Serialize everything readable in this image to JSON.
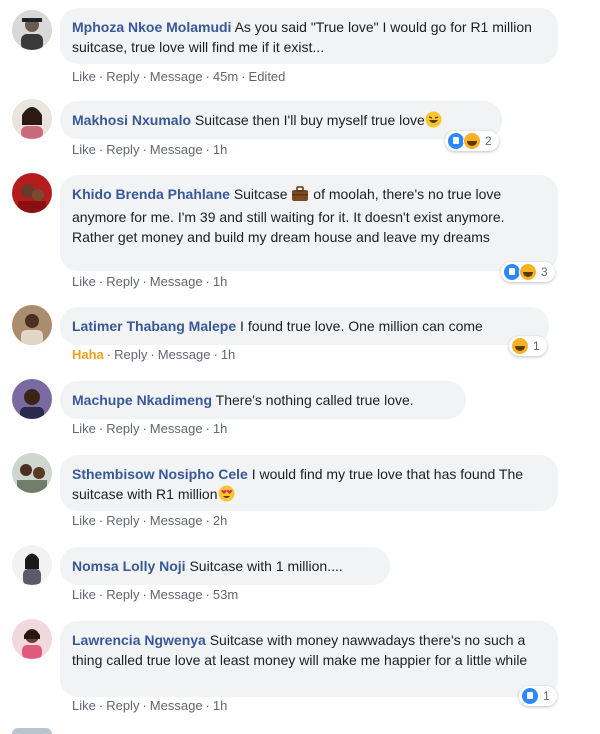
{
  "comments": [
    {
      "author": "Mphoza Nkoe Molamudi",
      "text": "As you said \"True love\" I would go for R1 million suitcase, true love will find me if it exist...",
      "actions": [
        "Like",
        "Reply",
        "Message"
      ],
      "time": "45m",
      "edited": "Edited"
    },
    {
      "author": "Makhosi Nxumalo",
      "text": "Suitcase then I'll buy myself true love",
      "actions": [
        "Like",
        "Reply",
        "Message"
      ],
      "time": "1h",
      "reaction_count": "2"
    },
    {
      "author": "Khido Brenda Phahlane",
      "text": "Suitcase",
      "text2": "of moolah, there's no true love anymore for me. I'm 39 and still waiting for it. It doesn't exist anymore. Rather get money and build my dream house and leave my dreams",
      "actions": [
        "Like",
        "Reply",
        "Message"
      ],
      "time": "1h",
      "reaction_count": "3"
    },
    {
      "author": "Latimer Thabang Malepe",
      "text": "I found true love. One million can come",
      "actions": [
        "Haha",
        "Reply",
        "Message"
      ],
      "time": "1h",
      "reaction_count": "1"
    },
    {
      "author": "Machupe Nkadimeng",
      "text": "There's nothing called true love.",
      "actions": [
        "Like",
        "Reply",
        "Message"
      ],
      "time": "1h"
    },
    {
      "author": "Sthembisow Nosipho Cele",
      "text": "I would find my true love that has found The suitcase with R1 million",
      "actions": [
        "Like",
        "Reply",
        "Message"
      ],
      "time": "2h"
    },
    {
      "author": "Nomsa Lolly Noji",
      "text": "Suitcase with 1 million....",
      "actions": [
        "Like",
        "Reply",
        "Message"
      ],
      "time": "53m"
    },
    {
      "author": "Lawrencia Ngwenya",
      "text": "Suitcase with money nawwadays there's no such a thing called true love at least money will make me happier for a little while",
      "actions": [
        "Like",
        "Reply",
        "Message"
      ],
      "time": "1h",
      "reaction_count": "1"
    }
  ],
  "colors": {
    "author": "#385898",
    "bubble": "#f2f3f5",
    "meta": "#606770",
    "like": "#2d88ff",
    "haha": "#f7b125"
  }
}
